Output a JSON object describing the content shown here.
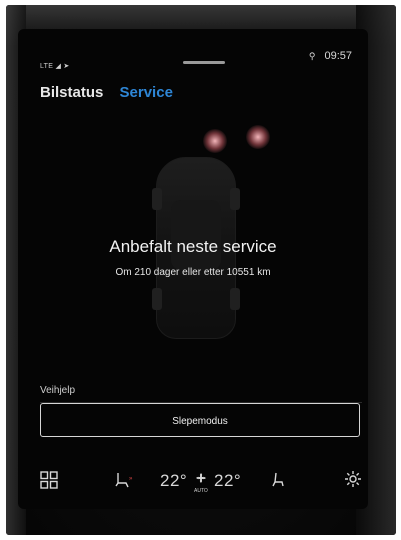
{
  "status_bar": {
    "network_label": "LTE",
    "signal_icon": "signal-icon",
    "location_icon": "location-arrow-icon",
    "user_icon": "user-icon",
    "clock": "09:57"
  },
  "tabs": [
    {
      "label": "Bilstatus",
      "active": false
    },
    {
      "label": "Service",
      "active": true
    }
  ],
  "service": {
    "title": "Anbefalt neste service",
    "detail": "Om 210 dager eller etter 10551 km"
  },
  "roadside": {
    "section_label": "Veihjelp",
    "button_label": "Slepemodus"
  },
  "climate_bar": {
    "left_temp": "22°",
    "right_temp": "22°",
    "fan_mode": "AUTO",
    "icons": [
      "app-grid-icon",
      "seat-heat-icon",
      "fan-icon",
      "seat-icon",
      "settings-gear-icon"
    ]
  },
  "colors": {
    "accent": "#2e86d6",
    "screen_background": "#050505",
    "text": "#f2f2f2"
  }
}
